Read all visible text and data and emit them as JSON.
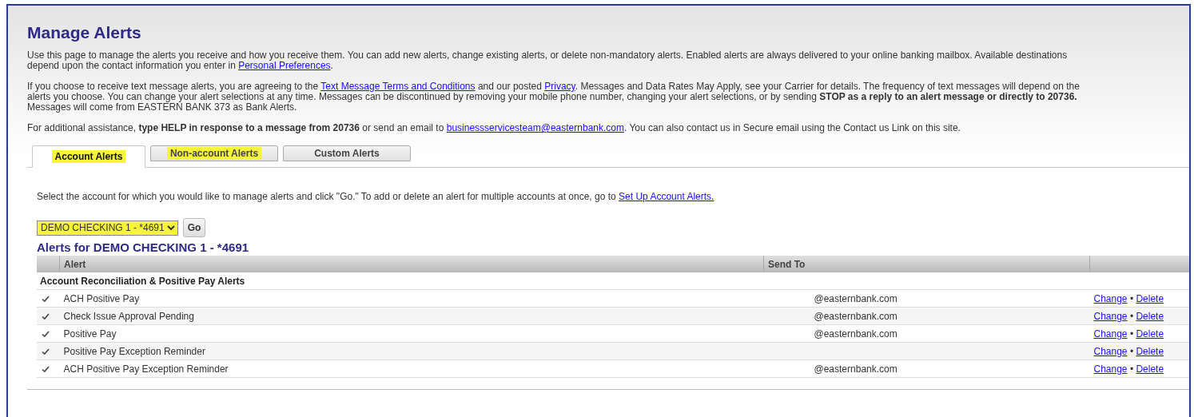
{
  "title": "Manage Alerts",
  "intro": [
    [
      {
        "kind": "text",
        "text": "Use this page to manage the alerts you receive and how you receive them. You can add new alerts, change existing alerts, or delete non-mandatory alerts. Enabled alerts are always delivered to your online banking mailbox. Available destinations depend upon the contact information you enter in "
      },
      {
        "kind": "link",
        "text": "Personal Preferences"
      },
      {
        "kind": "text",
        "text": "."
      }
    ],
    [
      {
        "kind": "text",
        "text": "If you choose to receive text message alerts, you are agreeing to the "
      },
      {
        "kind": "link",
        "text": "Text Message Terms and Conditions"
      },
      {
        "kind": "text",
        "text": " and our posted "
      },
      {
        "kind": "link",
        "text": "Privacy"
      },
      {
        "kind": "text",
        "text": ". Messages and Data Rates May Apply, see your Carrier for details. The frequency of text messages will depend on the alerts you choose. You can change your alert selections at any time. Messages can be discontinued by removing your mobile phone number, changing your alert selections, or by sending "
      },
      {
        "kind": "bold",
        "text": "STOP as a reply to an alert message or directly to 20736."
      },
      {
        "kind": "text",
        "text": " Messages will come from EASTERN BANK 373 as Bank Alerts."
      }
    ],
    [
      {
        "kind": "text",
        "text": "For additional assistance, "
      },
      {
        "kind": "bold",
        "text": "type HELP in response to a message from 20736"
      },
      {
        "kind": "text",
        "text": " or send an email to "
      },
      {
        "kind": "link",
        "text": "businessservicesteam@easternbank.com"
      },
      {
        "kind": "text",
        "text": ". You can also contact us in Secure email using the Contact us Link on this site."
      }
    ]
  ],
  "tabs": [
    {
      "label": "Account Alerts",
      "selected": true,
      "highlighted": true
    },
    {
      "label": "Non-account Alerts",
      "selected": false,
      "highlighted": true
    },
    {
      "label": "Custom Alerts",
      "selected": false,
      "highlighted": false
    }
  ],
  "instruction": [
    {
      "kind": "text",
      "text": "Select the account for which you would like to manage alerts and click \"Go.\" To add or delete an alert for multiple accounts at once, go to "
    },
    {
      "kind": "link",
      "text": "Set Up Account Alerts."
    }
  ],
  "account_select": {
    "value": "DEMO CHECKING 1 - *4691",
    "highlighted": true
  },
  "go_button": "Go",
  "alerts_heading": "Alerts for DEMO CHECKING 1 - *4691",
  "table": {
    "columns": [
      "Alert",
      "Send To"
    ],
    "group": "Account Reconciliation & Positive Pay Alerts",
    "rows": [
      {
        "checked": true,
        "alert": "ACH Positive Pay",
        "send_to": "@easternbank.com",
        "change": "Change",
        "separator": "•",
        "delete": "Delete"
      },
      {
        "checked": true,
        "alert": "Check Issue Approval Pending",
        "send_to": "@easternbank.com",
        "change": "Change",
        "separator": "•",
        "delete": "Delete"
      },
      {
        "checked": true,
        "alert": "Positive Pay",
        "send_to": "@easternbank.com",
        "change": "Change",
        "separator": "•",
        "delete": "Delete"
      },
      {
        "checked": true,
        "alert": "Positive Pay Exception Reminder",
        "change": "Change",
        "separator": "•",
        "delete": "Delete"
      },
      {
        "checked": true,
        "alert": "ACH Positive Pay Exception Reminder",
        "send_to": "@easternbank.com",
        "change": "Change",
        "separator": "•",
        "delete": "Delete"
      }
    ]
  }
}
